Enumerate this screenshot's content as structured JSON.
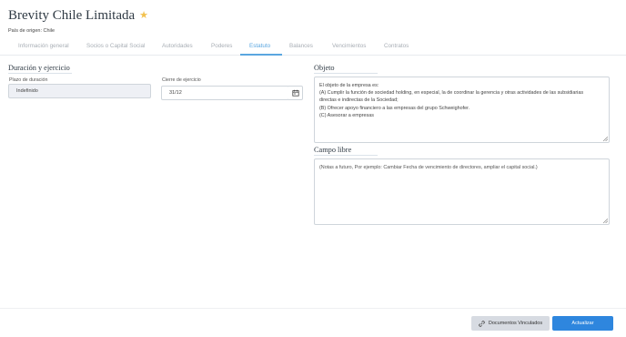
{
  "header": {
    "company_name": "Brevity Chile Limitada",
    "origin": "País de origen: Chile"
  },
  "tabs": [
    {
      "label": "Información general"
    },
    {
      "label": "Socios o Capital Social"
    },
    {
      "label": "Autoridades"
    },
    {
      "label": "Poderes"
    },
    {
      "label": "Estatuto",
      "active": true
    },
    {
      "label": "Balances"
    },
    {
      "label": "Vencimientos"
    },
    {
      "label": "Contratos"
    }
  ],
  "duracion": {
    "title": "Duración y ejercicio",
    "plazo_label": "Plazo de duración",
    "plazo_value": "Indefinido",
    "cierre_label": "Cierre de ejercicio",
    "cierre_value": "31/12"
  },
  "objeto": {
    "title": "Objeto",
    "lines": [
      "El objeto de la empresa es:",
      "(A) Cumplir la función de sociedad holding, en especial, la de coordinar la gerencia y otras actividades de las subsidiarias",
      "directas e indirectas de la Sociedad;",
      "(B) Ofrecer apoyo financiero a las empresas del grupo Schweighofer.",
      "(C) Asesorar a empresas"
    ]
  },
  "campo_libre": {
    "title": "Campo libre",
    "placeholder": "(Notas a futuro, Por ejemplo: Cambiar Fecha de vencimiento de directores, ampliar el capital social.)"
  },
  "footer": {
    "docs_label": "Documentos Vinculados",
    "update_label": "Actualizar"
  },
  "colors": {
    "accent": "#5aa6e0",
    "primary_button": "#2e86de",
    "star": "#f2c14e"
  }
}
